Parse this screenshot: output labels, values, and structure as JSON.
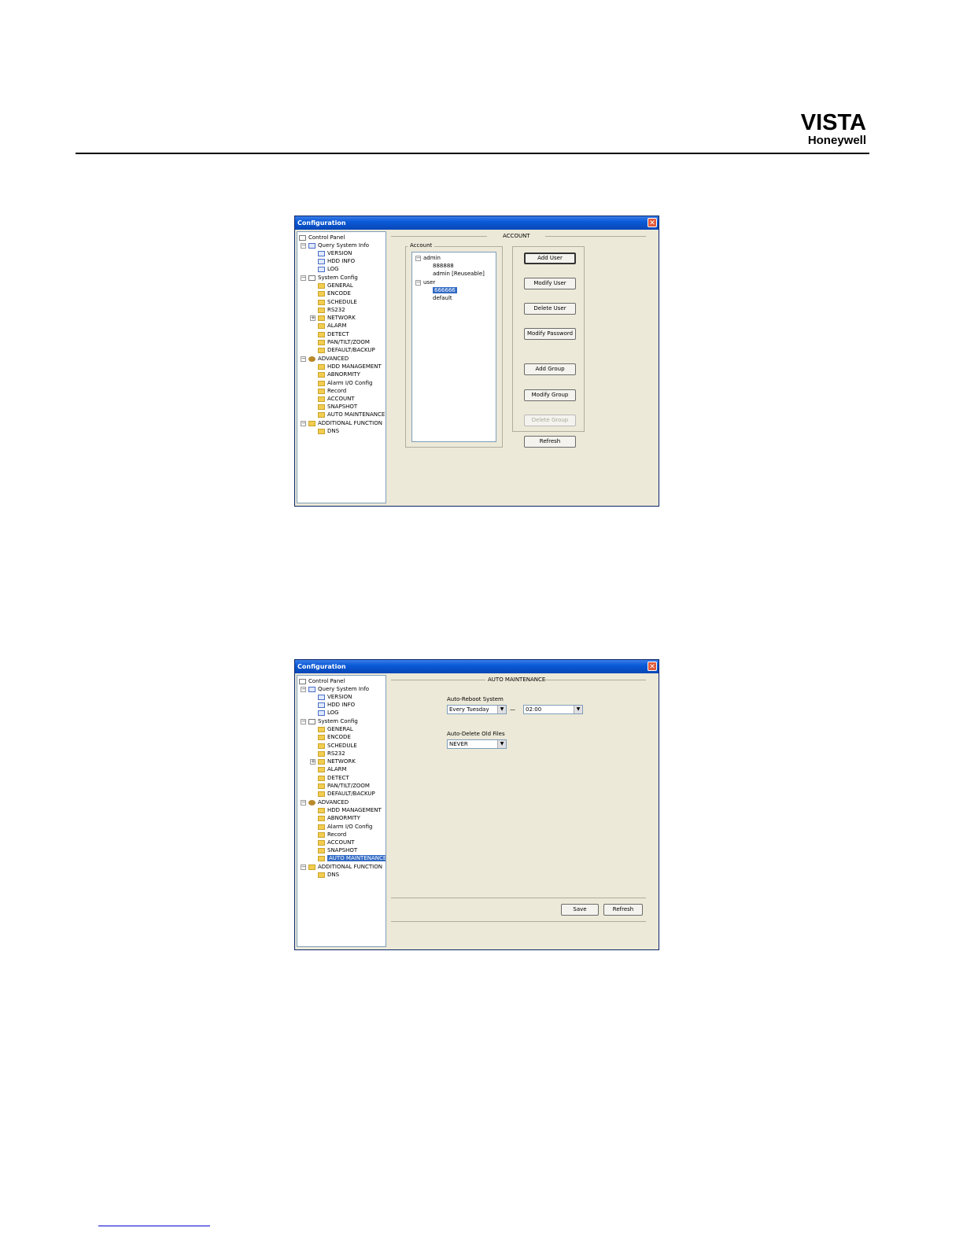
{
  "header": {
    "brand": "VISTA",
    "sub_brand": "Honeywell"
  },
  "window_title": "Configuration",
  "tree": {
    "control_panel": "Control Panel",
    "query_system_info": "Query System Info",
    "version": "VERSION",
    "hdd_info": "HDD INFO",
    "log": "LOG",
    "system_config": "System Config",
    "general": "GENERAL",
    "encode": "ENCODE",
    "schedule": "SCHEDULE",
    "rs232": "RS232",
    "network": "NETWORK",
    "alarm": "ALARM",
    "detect": "DETECT",
    "ptz": "PAN/TILT/ZOOM",
    "default_backup": "DEFAULT/BACKUP",
    "advanced": "ADVANCED",
    "hdd_management": "HDD MANAGEMENT",
    "abnormity": "ABNORMITY",
    "alarm_io": "Alarm I/O Config",
    "record": "Record",
    "account": "ACCOUNT",
    "snapshot": "SNAPSHOT",
    "auto_maintenance": "AUTO MAINTENANCE",
    "additional_function": "ADDITIONAL FUNCTION",
    "dns": "DNS"
  },
  "account_window": {
    "section_title": "ACCOUNT",
    "group_label": "Account",
    "accounts": {
      "admin": "admin",
      "admin_888888": "888888",
      "admin_reusable": "admin [Reuseable]",
      "user": "user",
      "user_666666": "666666",
      "user_default": "default"
    },
    "buttons": {
      "add_user": "Add User",
      "modify_user": "Modify User",
      "delete_user": "Delete User",
      "modify_password": "Modify Password",
      "add_group": "Add Group",
      "modify_group": "Modify Group",
      "delete_group": "Delete Group",
      "refresh": "Refresh"
    }
  },
  "maintenance_window": {
    "section_title": "AUTO MAINTENANCE",
    "auto_reboot_label": "Auto-Reboot System",
    "reboot_day": "Every Tuesday",
    "dash": "—",
    "reboot_time": "02:00",
    "auto_delete_label": "Auto-Delete Old Files",
    "delete_value": "NEVER",
    "buttons": {
      "save": "Save",
      "refresh": "Refresh"
    }
  }
}
